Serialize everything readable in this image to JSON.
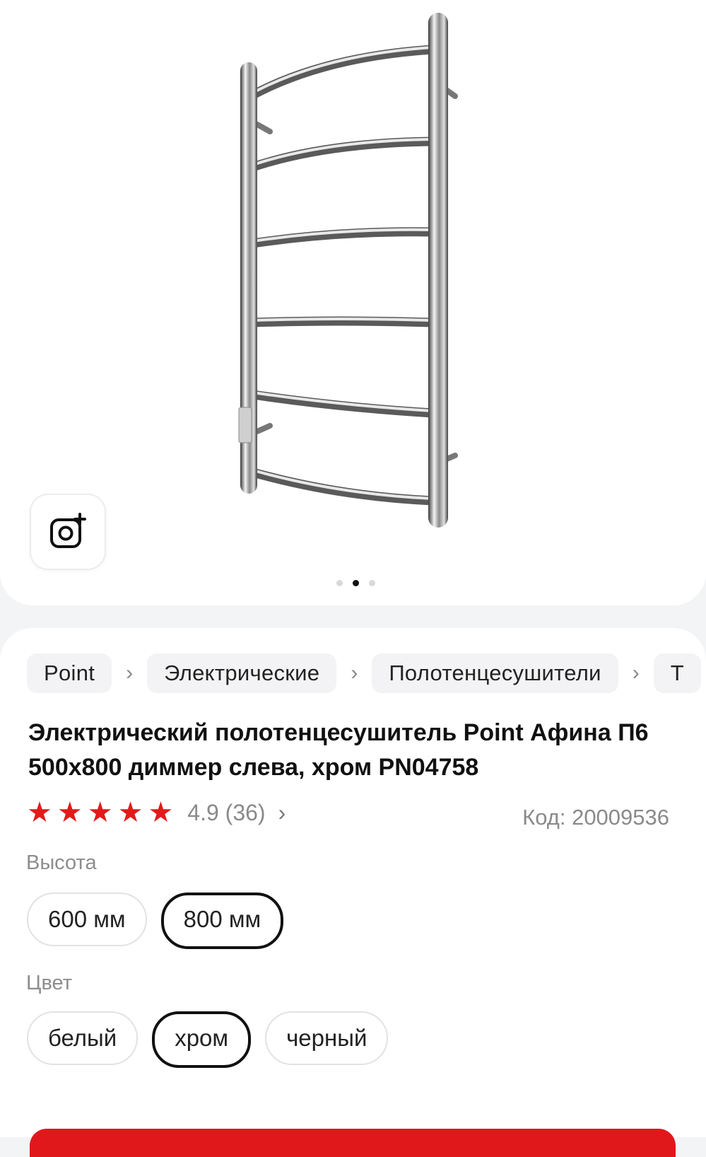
{
  "gallery": {
    "icons": {
      "ar": "camera-plus-icon"
    },
    "pagination": {
      "total": 3,
      "active": 2
    }
  },
  "breadcrumbs": [
    {
      "label": "Point"
    },
    {
      "label": "Электрические"
    },
    {
      "label": "Полотенцесушители"
    },
    {
      "label": "Т"
    }
  ],
  "product": {
    "title_line1": "Электрический полотенцесушитель Point Афина П6",
    "title_line2": "500x800 диммер слева, хром PN04758",
    "rating_value": "4.9 (36)",
    "rating_stars": 5,
    "rating_chevron": "›",
    "code_text": "Код: 20009536"
  },
  "options": {
    "height": {
      "label": "Высота",
      "values": [
        "600 мм",
        "800 мм"
      ],
      "selected": "800 мм"
    },
    "color": {
      "label": "Цвет",
      "values": [
        "белый",
        "хром",
        "черный"
      ],
      "selected": "хром"
    }
  },
  "colors": {
    "accent": "#e21a1a",
    "cta": "#e0181b"
  }
}
